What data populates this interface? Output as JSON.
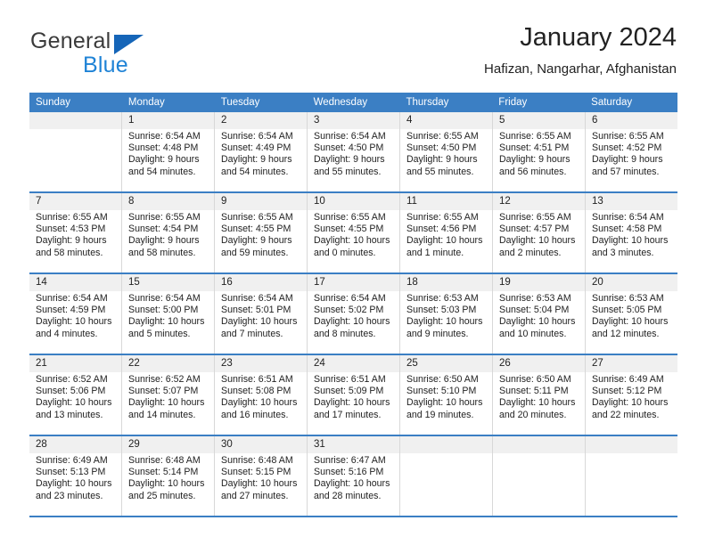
{
  "brand": {
    "name_part1": "General",
    "name_part2": "Blue",
    "logo_icon": "triangle-icon",
    "colors": {
      "general_text": "#3b3b3b",
      "blue_text": "#1f83d6",
      "triangle": "#1565b8",
      "header_bar": "#3b7fc4",
      "daynum_band": "#f0f0f0",
      "cell_border": "#d8d8d8"
    }
  },
  "header": {
    "title": "January 2024",
    "subtitle": "Hafizan, Nangarhar, Afghanistan"
  },
  "weekdays": [
    "Sunday",
    "Monday",
    "Tuesday",
    "Wednesday",
    "Thursday",
    "Friday",
    "Saturday"
  ],
  "weeks": [
    {
      "daynums": [
        "",
        "1",
        "2",
        "3",
        "4",
        "5",
        "6"
      ],
      "cells": [
        {
          "empty": true
        },
        {
          "sunrise": "Sunrise: 6:54 AM",
          "sunset": "Sunset: 4:48 PM",
          "daylight": "Daylight: 9 hours and 54 minutes."
        },
        {
          "sunrise": "Sunrise: 6:54 AM",
          "sunset": "Sunset: 4:49 PM",
          "daylight": "Daylight: 9 hours and 54 minutes."
        },
        {
          "sunrise": "Sunrise: 6:54 AM",
          "sunset": "Sunset: 4:50 PM",
          "daylight": "Daylight: 9 hours and 55 minutes."
        },
        {
          "sunrise": "Sunrise: 6:55 AM",
          "sunset": "Sunset: 4:50 PM",
          "daylight": "Daylight: 9 hours and 55 minutes."
        },
        {
          "sunrise": "Sunrise: 6:55 AM",
          "sunset": "Sunset: 4:51 PM",
          "daylight": "Daylight: 9 hours and 56 minutes."
        },
        {
          "sunrise": "Sunrise: 6:55 AM",
          "sunset": "Sunset: 4:52 PM",
          "daylight": "Daylight: 9 hours and 57 minutes."
        }
      ]
    },
    {
      "daynums": [
        "7",
        "8",
        "9",
        "10",
        "11",
        "12",
        "13"
      ],
      "cells": [
        {
          "sunrise": "Sunrise: 6:55 AM",
          "sunset": "Sunset: 4:53 PM",
          "daylight": "Daylight: 9 hours and 58 minutes."
        },
        {
          "sunrise": "Sunrise: 6:55 AM",
          "sunset": "Sunset: 4:54 PM",
          "daylight": "Daylight: 9 hours and 58 minutes."
        },
        {
          "sunrise": "Sunrise: 6:55 AM",
          "sunset": "Sunset: 4:55 PM",
          "daylight": "Daylight: 9 hours and 59 minutes."
        },
        {
          "sunrise": "Sunrise: 6:55 AM",
          "sunset": "Sunset: 4:55 PM",
          "daylight": "Daylight: 10 hours and 0 minutes."
        },
        {
          "sunrise": "Sunrise: 6:55 AM",
          "sunset": "Sunset: 4:56 PM",
          "daylight": "Daylight: 10 hours and 1 minute."
        },
        {
          "sunrise": "Sunrise: 6:55 AM",
          "sunset": "Sunset: 4:57 PM",
          "daylight": "Daylight: 10 hours and 2 minutes."
        },
        {
          "sunrise": "Sunrise: 6:54 AM",
          "sunset": "Sunset: 4:58 PM",
          "daylight": "Daylight: 10 hours and 3 minutes."
        }
      ]
    },
    {
      "daynums": [
        "14",
        "15",
        "16",
        "17",
        "18",
        "19",
        "20"
      ],
      "cells": [
        {
          "sunrise": "Sunrise: 6:54 AM",
          "sunset": "Sunset: 4:59 PM",
          "daylight": "Daylight: 10 hours and 4 minutes."
        },
        {
          "sunrise": "Sunrise: 6:54 AM",
          "sunset": "Sunset: 5:00 PM",
          "daylight": "Daylight: 10 hours and 5 minutes."
        },
        {
          "sunrise": "Sunrise: 6:54 AM",
          "sunset": "Sunset: 5:01 PM",
          "daylight": "Daylight: 10 hours and 7 minutes."
        },
        {
          "sunrise": "Sunrise: 6:54 AM",
          "sunset": "Sunset: 5:02 PM",
          "daylight": "Daylight: 10 hours and 8 minutes."
        },
        {
          "sunrise": "Sunrise: 6:53 AM",
          "sunset": "Sunset: 5:03 PM",
          "daylight": "Daylight: 10 hours and 9 minutes."
        },
        {
          "sunrise": "Sunrise: 6:53 AM",
          "sunset": "Sunset: 5:04 PM",
          "daylight": "Daylight: 10 hours and 10 minutes."
        },
        {
          "sunrise": "Sunrise: 6:53 AM",
          "sunset": "Sunset: 5:05 PM",
          "daylight": "Daylight: 10 hours and 12 minutes."
        }
      ]
    },
    {
      "daynums": [
        "21",
        "22",
        "23",
        "24",
        "25",
        "26",
        "27"
      ],
      "cells": [
        {
          "sunrise": "Sunrise: 6:52 AM",
          "sunset": "Sunset: 5:06 PM",
          "daylight": "Daylight: 10 hours and 13 minutes."
        },
        {
          "sunrise": "Sunrise: 6:52 AM",
          "sunset": "Sunset: 5:07 PM",
          "daylight": "Daylight: 10 hours and 14 minutes."
        },
        {
          "sunrise": "Sunrise: 6:51 AM",
          "sunset": "Sunset: 5:08 PM",
          "daylight": "Daylight: 10 hours and 16 minutes."
        },
        {
          "sunrise": "Sunrise: 6:51 AM",
          "sunset": "Sunset: 5:09 PM",
          "daylight": "Daylight: 10 hours and 17 minutes."
        },
        {
          "sunrise": "Sunrise: 6:50 AM",
          "sunset": "Sunset: 5:10 PM",
          "daylight": "Daylight: 10 hours and 19 minutes."
        },
        {
          "sunrise": "Sunrise: 6:50 AM",
          "sunset": "Sunset: 5:11 PM",
          "daylight": "Daylight: 10 hours and 20 minutes."
        },
        {
          "sunrise": "Sunrise: 6:49 AM",
          "sunset": "Sunset: 5:12 PM",
          "daylight": "Daylight: 10 hours and 22 minutes."
        }
      ]
    },
    {
      "daynums": [
        "28",
        "29",
        "30",
        "31",
        "",
        "",
        ""
      ],
      "cells": [
        {
          "sunrise": "Sunrise: 6:49 AM",
          "sunset": "Sunset: 5:13 PM",
          "daylight": "Daylight: 10 hours and 23 minutes."
        },
        {
          "sunrise": "Sunrise: 6:48 AM",
          "sunset": "Sunset: 5:14 PM",
          "daylight": "Daylight: 10 hours and 25 minutes."
        },
        {
          "sunrise": "Sunrise: 6:48 AM",
          "sunset": "Sunset: 5:15 PM",
          "daylight": "Daylight: 10 hours and 27 minutes."
        },
        {
          "sunrise": "Sunrise: 6:47 AM",
          "sunset": "Sunset: 5:16 PM",
          "daylight": "Daylight: 10 hours and 28 minutes."
        },
        {
          "empty": true
        },
        {
          "empty": true
        },
        {
          "empty": true
        }
      ]
    }
  ]
}
